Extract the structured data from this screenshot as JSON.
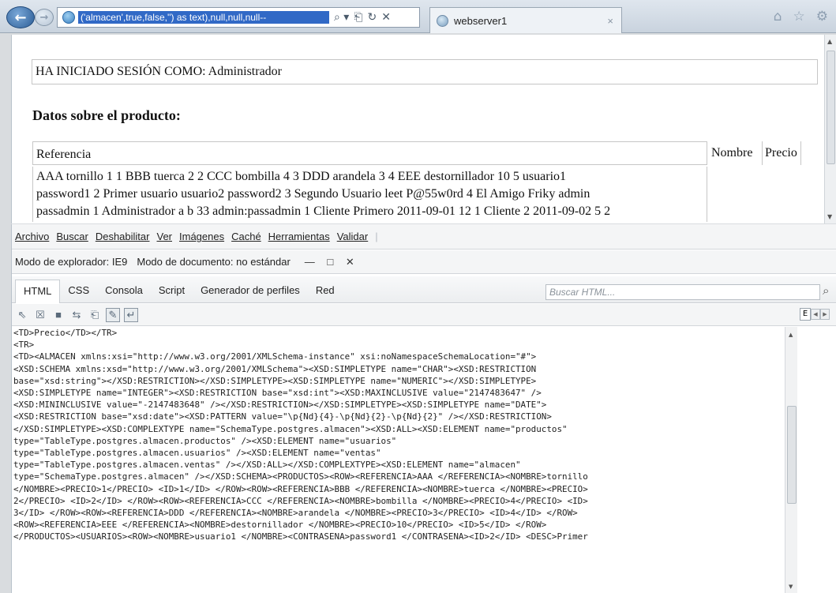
{
  "browser": {
    "address_text": "('almacen',true,false,'') as text),null,null,null--",
    "search_arrow": "⌕ ▾",
    "tab_title": "webserver1",
    "tab_close": "×"
  },
  "page": {
    "session_text": "HA INICIADO SESIÓN COMO: Administrador",
    "section_heading": "Datos sobre el producto:",
    "table": {
      "headers": [
        "Referencia",
        "Nombre",
        "Precio"
      ],
      "data_line_1": "AAA tornillo 1 1 BBB tuerca 2 2 CCC bombilla 4 3 DDD arandela 3 4 EEE destornillador 10 5 usuario1",
      "data_line_2": "password1 2 Primer usuario usuario2 password2 3 Segundo Usuario leet P@55w0rd 4 El Amigo Friky admin",
      "data_line_3": "passadmin 1 Administrador a b 33 admin:passadmin 1 Cliente Primero 2011-09-01 12 1 Cliente 2 2011-09-02 5 2"
    }
  },
  "devtools": {
    "menu": [
      "Archivo",
      "Buscar",
      "Deshabilitar",
      "Ver",
      "Imágenes",
      "Caché",
      "Herramientas",
      "Validar"
    ],
    "browser_mode": "Modo de explorador: IE9",
    "document_mode": "Modo de documento: no estándar",
    "window_controls": "— □ ✕",
    "tabs": [
      "HTML",
      "CSS",
      "Consola",
      "Script",
      "Generador de perfiles",
      "Red"
    ],
    "search_placeholder": "Buscar HTML...",
    "side_label": "E",
    "code_lines": [
      "<TD>Precio</TD></TR>",
      "<TR>",
      "<TD><ALMACEN xmlns:xsi=\"http://www.w3.org/2001/XMLSchema-instance\" xsi:noNamespaceSchemaLocation=\"#\">",
      "<XSD:SCHEMA xmlns:xsd=\"http://www.w3.org/2001/XMLSchema\"><XSD:SIMPLETYPE name=\"CHAR\"><XSD:RESTRICTION",
      "base=\"xsd:string\"></XSD:RESTRICTION></XSD:SIMPLETYPE><XSD:SIMPLETYPE name=\"NUMERIC\"></XSD:SIMPLETYPE>",
      "<XSD:SIMPLETYPE name=\"INTEGER\"><XSD:RESTRICTION base=\"xsd:int\"><XSD:MAXINCLUSIVE value=\"2147483647\" />",
      "<XSD:MININCLUSIVE value=\"-2147483648\" /></XSD:RESTRICTION></XSD:SIMPLETYPE><XSD:SIMPLETYPE name=\"DATE\">",
      "<XSD:RESTRICTION base=\"xsd:date\"><XSD:PATTERN value=\"\\p{Nd}{4}-\\p{Nd}{2}-\\p{Nd}{2}\" /></XSD:RESTRICTION>",
      "</XSD:SIMPLETYPE><XSD:COMPLEXTYPE name=\"SchemaType.postgres.almacen\"><XSD:ALL><XSD:ELEMENT name=\"productos\"",
      "type=\"TableType.postgres.almacen.productos\" /><XSD:ELEMENT name=\"usuarios\"",
      "type=\"TableType.postgres.almacen.usuarios\" /><XSD:ELEMENT name=\"ventas\"",
      "type=\"TableType.postgres.almacen.ventas\" /></XSD:ALL></XSD:COMPLEXTYPE><XSD:ELEMENT name=\"almacen\"",
      "type=\"SchemaType.postgres.almacen\" /></XSD:SCHEMA><PRODUCTOS><ROW><REFERENCIA>AAA </REFERENCIA><NOMBRE>tornillo",
      "</NOMBRE><PRECIO>1</PRECIO> <ID>1</ID> </ROW><ROW><REFERENCIA>BBB </REFERENCIA><NOMBRE>tuerca </NOMBRE><PRECIO>",
      "2</PRECIO> <ID>2</ID> </ROW><ROW><REFERENCIA>CCC </REFERENCIA><NOMBRE>bombilla </NOMBRE><PRECIO>4</PRECIO> <ID>",
      "3</ID> </ROW><ROW><REFERENCIA>DDD </REFERENCIA><NOMBRE>arandela </NOMBRE><PRECIO>3</PRECIO> <ID>4</ID> </ROW>",
      "<ROW><REFERENCIA>EEE </REFERENCIA><NOMBRE>destornillador </NOMBRE><PRECIO>10</PRECIO> <ID>5</ID> </ROW>",
      "</PRODUCTOS><USUARIOS><ROW><NOMBRE>usuario1 </NOMBRE><CONTRASENA>password1 </CONTRASENA><ID>2</ID> <DESC>Primer"
    ]
  }
}
